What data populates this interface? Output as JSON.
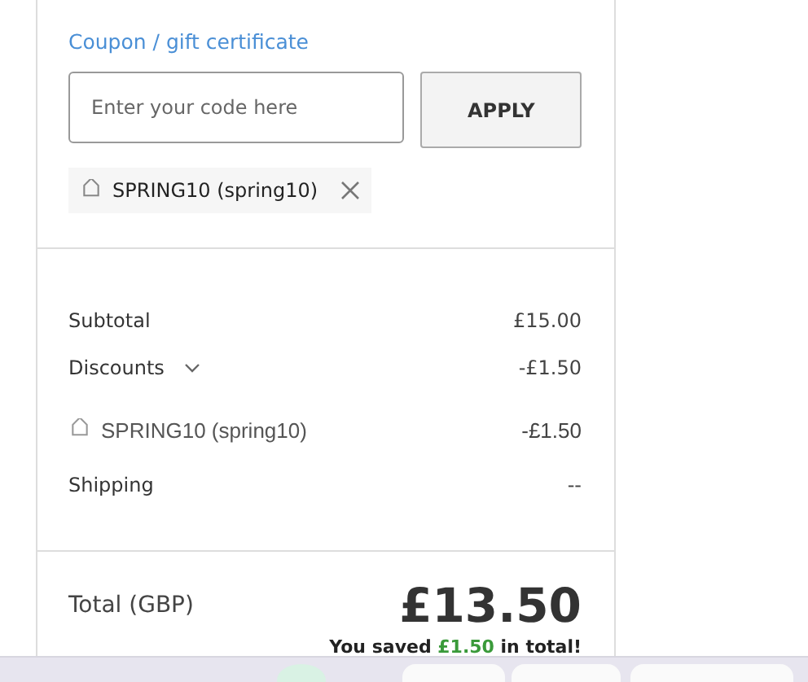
{
  "coupon": {
    "heading": "Coupon / gift certificate",
    "input": {
      "placeholder": "Enter your code here"
    },
    "button": "APPLY",
    "applied": [
      {
        "label": "SPRING10 (spring10)"
      }
    ]
  },
  "summary": {
    "rows": [
      {
        "kind": "line",
        "label": "Subtotal",
        "value": "£15.00"
      },
      {
        "kind": "toggle",
        "label": "Discounts",
        "value": "-£1.50",
        "expanded": true
      },
      {
        "kind": "coupon",
        "label": "SPRING10 (spring10)",
        "value": "-£1.50"
      },
      {
        "kind": "line",
        "label": "Shipping",
        "value": "--"
      }
    ]
  },
  "total": {
    "label": "Total (GBP)",
    "amount": "£13.50",
    "saved": {
      "before": "You saved",
      "amount": "£1.50",
      "after": "in total!"
    }
  }
}
